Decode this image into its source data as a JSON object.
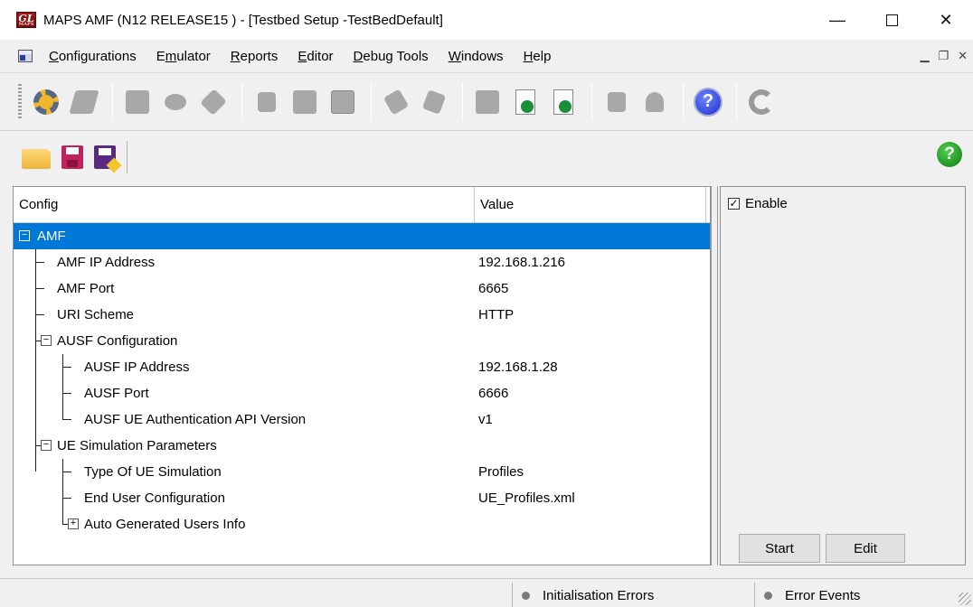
{
  "window": {
    "title": "MAPS AMF (N12 RELEASE15 ) - [Testbed Setup -TestBedDefault]",
    "logo_text": "GL",
    "logo_subtext": "MAPS"
  },
  "menu": {
    "items": [
      {
        "label": "Configurations",
        "accel": "C"
      },
      {
        "label": "Emulator",
        "accel": "m"
      },
      {
        "label": "Reports",
        "accel": "R"
      },
      {
        "label": "Editor",
        "accel": "E"
      },
      {
        "label": "Debug Tools",
        "accel": "D"
      },
      {
        "label": "Windows",
        "accel": "W"
      },
      {
        "label": "Help",
        "accel": "H"
      }
    ]
  },
  "grid": {
    "headers": {
      "config": "Config",
      "value": "Value"
    },
    "rows": [
      {
        "label": "AMF",
        "value": "",
        "level": 0,
        "expander": "minus",
        "selected": true
      },
      {
        "label": "AMF IP Address",
        "value": "192.168.1.216",
        "level": 1
      },
      {
        "label": "AMF Port",
        "value": "6665",
        "level": 1
      },
      {
        "label": "URI Scheme",
        "value": "HTTP",
        "level": 1
      },
      {
        "label": "AUSF Configuration",
        "value": "",
        "level": 1,
        "expander": "minus"
      },
      {
        "label": "AUSF IP Address",
        "value": "192.168.1.28",
        "level": 2
      },
      {
        "label": "AUSF Port",
        "value": "6666",
        "level": 2
      },
      {
        "label": "AUSF UE Authentication API Version",
        "value": "v1",
        "level": 2
      },
      {
        "label": "UE Simulation Parameters",
        "value": "",
        "level": 1,
        "expander": "minus"
      },
      {
        "label": "Type Of UE Simulation",
        "value": "Profiles",
        "level": 2
      },
      {
        "label": "End User Configuration",
        "value": "UE_Profiles.xml",
        "level": 2
      },
      {
        "label": "Auto Generated Users Info",
        "value": "",
        "level": 2,
        "expander": "plus"
      }
    ]
  },
  "right_panel": {
    "enable_label": "Enable",
    "enable_checked": true,
    "start_label": "Start",
    "edit_label": "Edit"
  },
  "status": {
    "init_errors": "Initialisation Errors",
    "error_events": "Error Events"
  },
  "colors": {
    "selection": "#0078d7",
    "help_green": "#0e7a0e",
    "help_blue": "#1d2ec9"
  }
}
